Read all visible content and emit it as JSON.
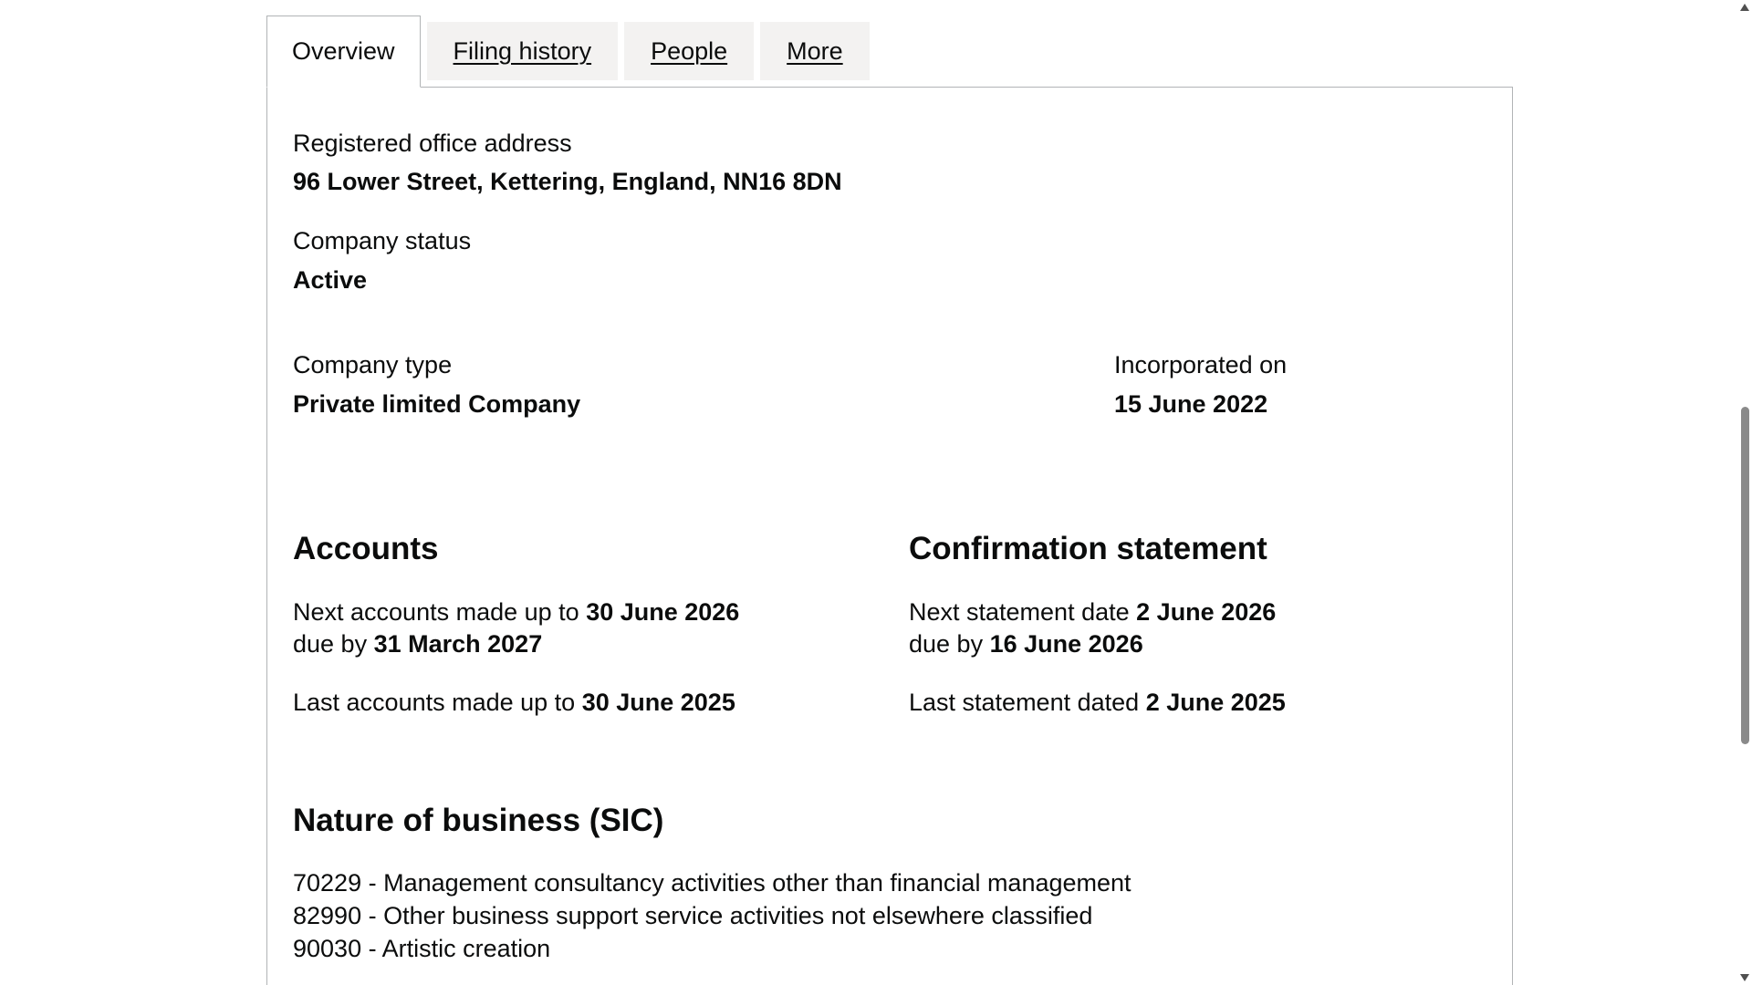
{
  "tabs": [
    {
      "label": "Overview",
      "active": true
    },
    {
      "label": "Filing history",
      "active": false
    },
    {
      "label": "People",
      "active": false
    },
    {
      "label": "More",
      "active": false
    }
  ],
  "overview": {
    "registered_office": {
      "label": "Registered office address",
      "value": "96 Lower Street, Kettering, England, NN16 8DN"
    },
    "company_status": {
      "label": "Company status",
      "value": "Active"
    },
    "company_type": {
      "label": "Company type",
      "value": "Private limited Company"
    },
    "incorporated": {
      "label": "Incorporated on",
      "value": "15 June 2022"
    }
  },
  "accounts": {
    "heading": "Accounts",
    "next_prefix": "Next accounts made up to",
    "next_date": "30 June 2026",
    "due_prefix": "due by",
    "due_date": "31 March 2027",
    "last_prefix": "Last accounts made up to",
    "last_date": "30 June 2025"
  },
  "confirmation": {
    "heading": "Confirmation statement",
    "next_prefix": "Next statement date",
    "next_date": "2 June 2026",
    "due_prefix": "due by",
    "due_date": "16 June 2026",
    "last_prefix": "Last statement dated",
    "last_date": "2 June 2025"
  },
  "sic": {
    "heading": "Nature of business (SIC)",
    "items": [
      "70229 - Management consultancy activities other than financial management",
      "82990 - Other business support service activities not elsewhere classified",
      "90030 - Artistic creation"
    ]
  }
}
